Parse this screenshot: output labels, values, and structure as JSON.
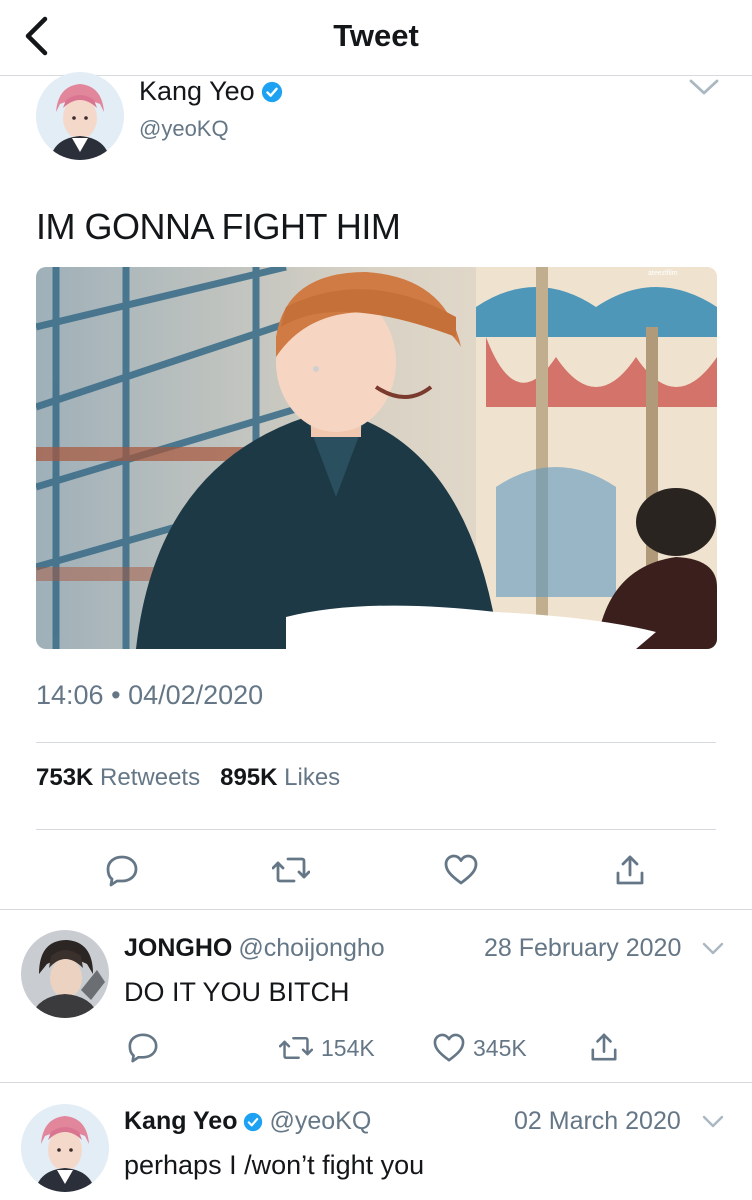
{
  "nav": {
    "title": "Tweet"
  },
  "tweet": {
    "author_name": "Kang Yeo",
    "author_handle": "@yeoKQ",
    "text": "IM GONNA FIGHT HIM",
    "media_watermark": "ateezlfilm",
    "time": "14:06",
    "date": "04/02/2020",
    "retweets_count": "753K",
    "retweets_label": "Retweets",
    "likes_count": "895K",
    "likes_label": "Likes"
  },
  "replies": [
    {
      "name": "JONGHO",
      "handle": "@choijongho",
      "date": "28 February 2020",
      "text": "DO IT YOU BITCH",
      "retweets": "154K",
      "likes": "345K",
      "verified": false
    },
    {
      "name": "Kang Yeo",
      "handle": "@yeoKQ",
      "date": "02 March 2020",
      "text": "perhaps I /won’t fight you",
      "verified": true
    }
  ],
  "colors": {
    "accent": "#1da1f2",
    "secondary_text": "#657786",
    "divider": "#d6dade"
  }
}
